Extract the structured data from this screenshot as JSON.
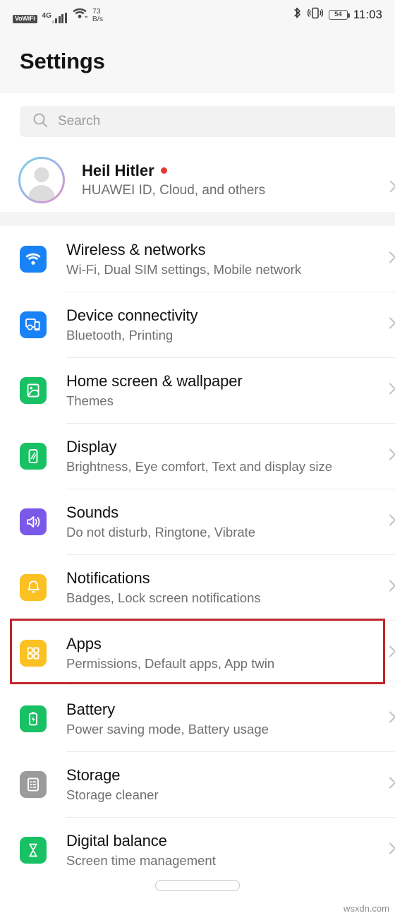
{
  "status_bar": {
    "vowifi_label": "VoWiFi",
    "network_gen": "4G",
    "net_speed_value": "73",
    "net_speed_unit": "B/s",
    "bluetooth_icon": "bluetooth-icon",
    "vibrate_icon": "vibrate-icon",
    "battery_level": "54",
    "time": "11:03"
  },
  "header": {
    "title": "Settings"
  },
  "search": {
    "placeholder": "Search",
    "icon": "search-icon",
    "value": ""
  },
  "profile": {
    "name": "Heil Hitler",
    "subtitle": "HUAWEI ID, Cloud, and others",
    "has_badge_dot": true,
    "badge_color": "#e53935",
    "avatar_icon": "person-avatar-icon"
  },
  "highlight": {
    "target": "Apps",
    "color": "#c0262b"
  },
  "settings_items": [
    {
      "title": "Wireless & networks",
      "subtitle": "Wi-Fi, Dual SIM settings, Mobile network",
      "icon": "wifi-icon",
      "icon_color": "#1a82f7",
      "name": "wireless-and-networks"
    },
    {
      "title": "Device connectivity",
      "subtitle": "Bluetooth, Printing",
      "icon": "device-connectivity-icon",
      "icon_color": "#1a82f7",
      "name": "device-connectivity"
    },
    {
      "title": "Home screen & wallpaper",
      "subtitle": "Themes",
      "icon": "image-wallpaper-icon",
      "icon_color": "#18c163",
      "name": "home-screen-and-wallpaper"
    },
    {
      "title": "Display",
      "subtitle": "Brightness, Eye comfort, Text and display size",
      "icon": "display-phone-icon",
      "icon_color": "#18c163",
      "name": "display"
    },
    {
      "title": "Sounds",
      "subtitle": "Do not disturb, Ringtone, Vibrate",
      "icon": "speaker-icon",
      "icon_color": "#7a58e8",
      "name": "sounds"
    },
    {
      "title": "Notifications",
      "subtitle": "Badges, Lock screen notifications",
      "icon": "bell-icon",
      "icon_color": "#fbc021",
      "name": "notifications"
    },
    {
      "title": "Apps",
      "subtitle": "Permissions, Default apps, App twin",
      "icon": "grid-apps-icon",
      "icon_color": "#fbc021",
      "name": "apps"
    },
    {
      "title": "Battery",
      "subtitle": "Power saving mode, Battery usage",
      "icon": "battery-charging-icon",
      "icon_color": "#18c163",
      "name": "battery"
    },
    {
      "title": "Storage",
      "subtitle": "Storage cleaner",
      "icon": "storage-list-icon",
      "icon_color": "#9b9b9b",
      "name": "storage"
    },
    {
      "title": "Digital balance",
      "subtitle": "Screen time management",
      "icon": "hourglass-icon",
      "icon_color": "#18c163",
      "name": "digital-balance"
    }
  ],
  "footer": {
    "watermark": "wsxdn.com",
    "home_indicator": "home-indicator"
  }
}
